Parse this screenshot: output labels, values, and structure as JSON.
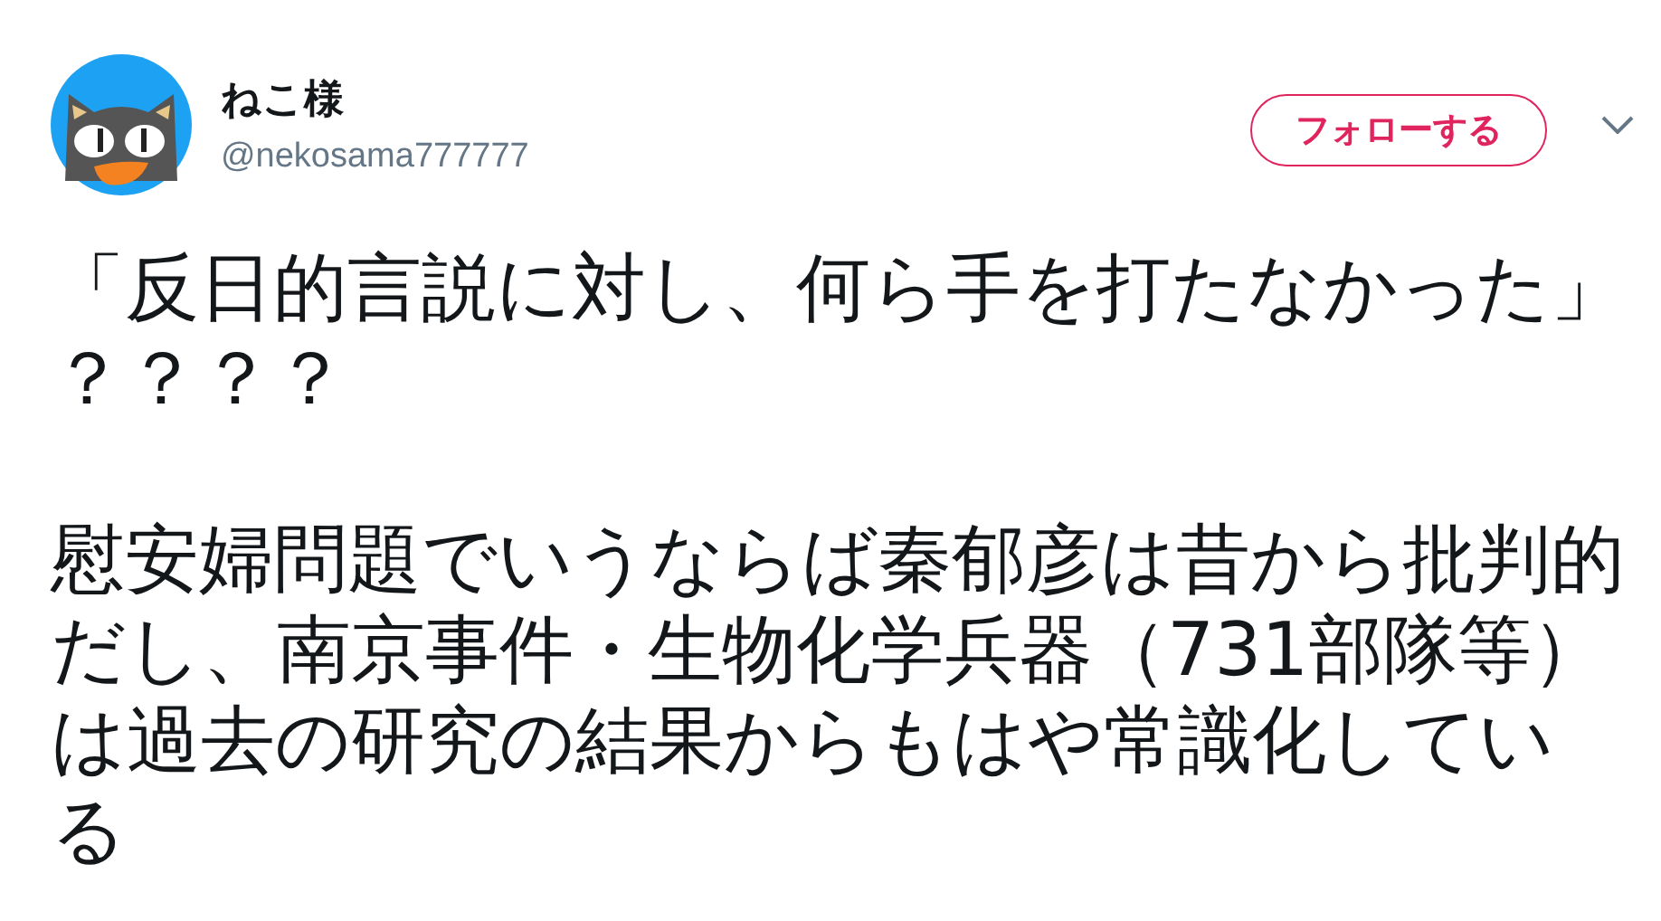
{
  "author": {
    "name": "ねこ様",
    "handle": "@nekosama777777"
  },
  "follow_button": {
    "label": "フォローする"
  },
  "tweet": {
    "paragraphs": [
      "「反日的言説に対し、何ら手を打たなかった」？？？？",
      "慰安婦問題でいうならば秦郁彦は昔から批判的だし、南京事件・生物化学兵器（731部隊等）は過去の研究の結果からもはや常識化している"
    ]
  }
}
